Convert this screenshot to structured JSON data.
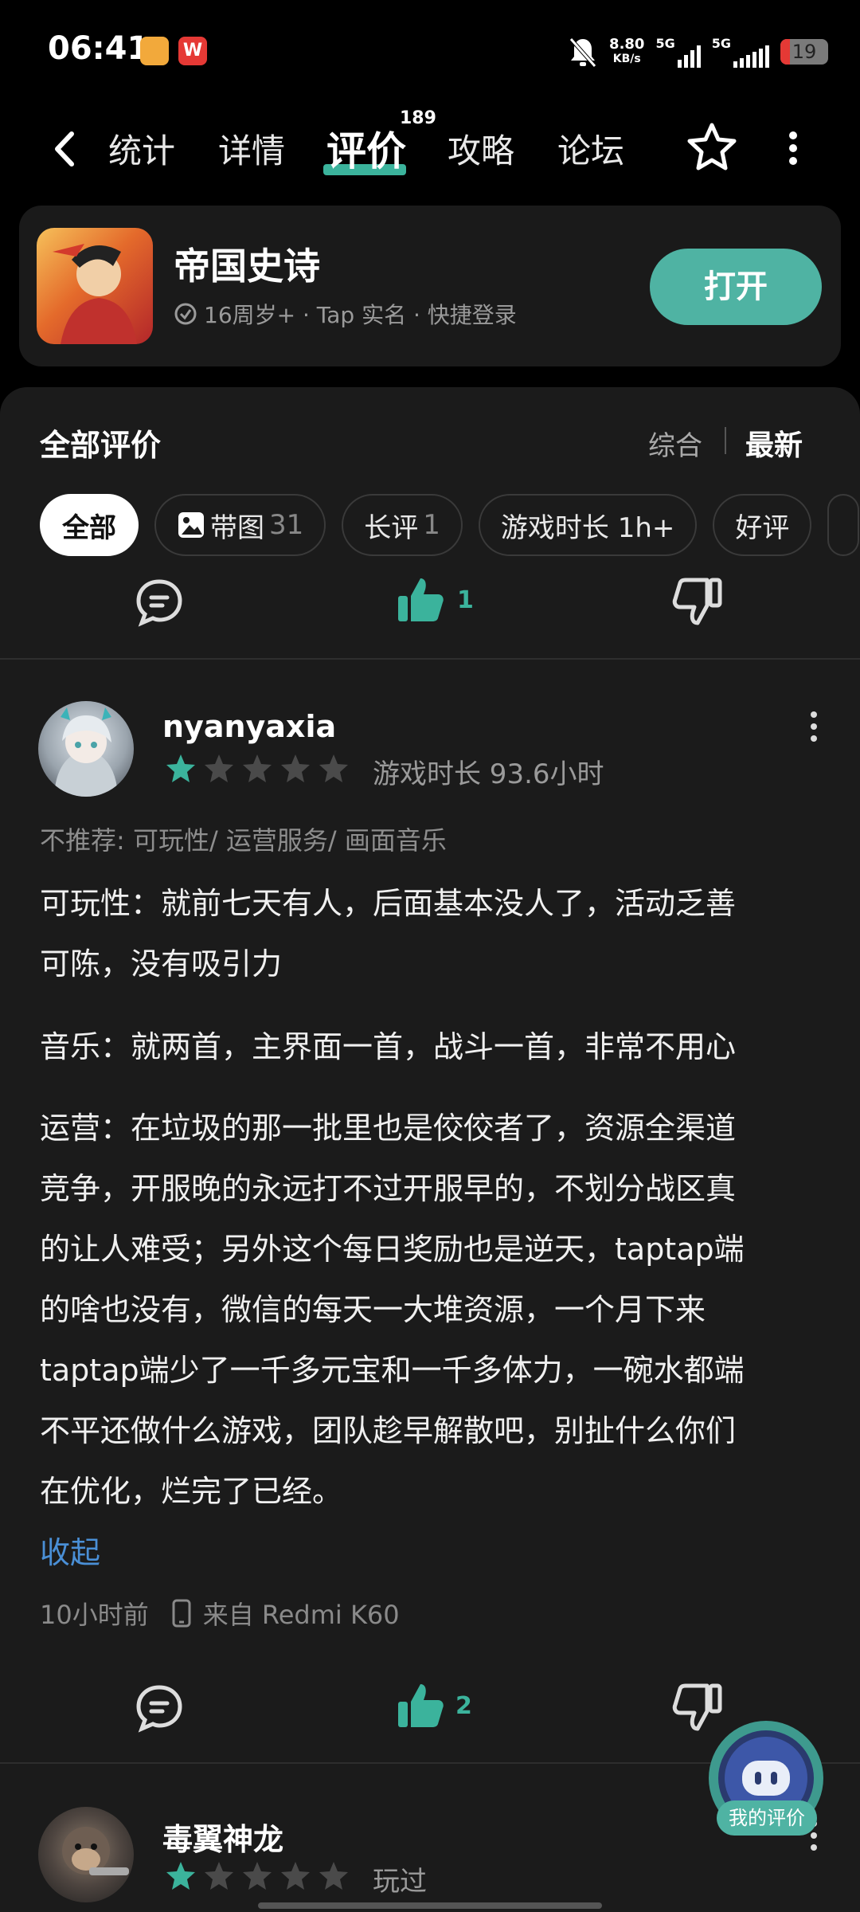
{
  "status_bar": {
    "time": "06:41",
    "net_speed_value": "8.80",
    "net_speed_unit": "KB/s",
    "sim1": "5G",
    "sim2": "5G",
    "battery": "19"
  },
  "nav": {
    "tabs": [
      {
        "label": "统计"
      },
      {
        "label": "详情"
      },
      {
        "label": "评价",
        "badge": "189"
      },
      {
        "label": "攻略"
      },
      {
        "label": "论坛"
      }
    ]
  },
  "app": {
    "name": "帝国史诗",
    "meta": "16周岁+ · Tap 实名 · 快捷登录",
    "open_label": "打开"
  },
  "reviews_header": {
    "title": "全部评价",
    "sort_combo": "综合",
    "sort_new": "最新"
  },
  "filters": [
    {
      "label": "全部"
    },
    {
      "label": "带图",
      "count": "31"
    },
    {
      "label": "长评",
      "count": "1"
    },
    {
      "label": "游戏时长 1h+"
    },
    {
      "label": "好评"
    }
  ],
  "prev_actions": {
    "like_count": "1"
  },
  "review1": {
    "username": "nyanyaxia",
    "rating": 1,
    "playtime": "游戏时长 93.6小时",
    "tags": "不推荐: 可玩性/ 运营服务/ 画面音乐",
    "para1_line1": "可玩性：就前七天有人，后面基本没人了，活动乏善",
    "para1_line2": "可陈，没有吸引力",
    "para2": "音乐：就两首，主界面一首，战斗一首，非常不用心",
    "para3_line1": "运营：在垃圾的那一批里也是佼佼者了，资源全渠道",
    "para3_line2": "竞争，开服晚的永远打不过开服早的，不划分战区真",
    "para3_line3": "的让人难受；另外这个每日奖励也是逆天，taptap端",
    "para3_line4": "的啥也没有，微信的每天一大堆资源，一个月下来",
    "para3_line5": "taptap端少了一千多元宝和一千多体力，一碗水都端",
    "para3_line6": "不平还做什么游戏，团队趁早解散吧，别扯什么你们",
    "para3_line7": "在优化，烂完了已经。",
    "collapse": "收起",
    "time": "10小时前",
    "device": "来自 Redmi K60",
    "like_count": "2"
  },
  "review2": {
    "username": "毒翼神龙",
    "rating": 1,
    "playtime": "玩过"
  },
  "fab": {
    "label": "我的评价"
  },
  "colors": {
    "accent": "#3bb39c",
    "link": "#4a8fd6",
    "open_button": "#4fb3a3"
  }
}
